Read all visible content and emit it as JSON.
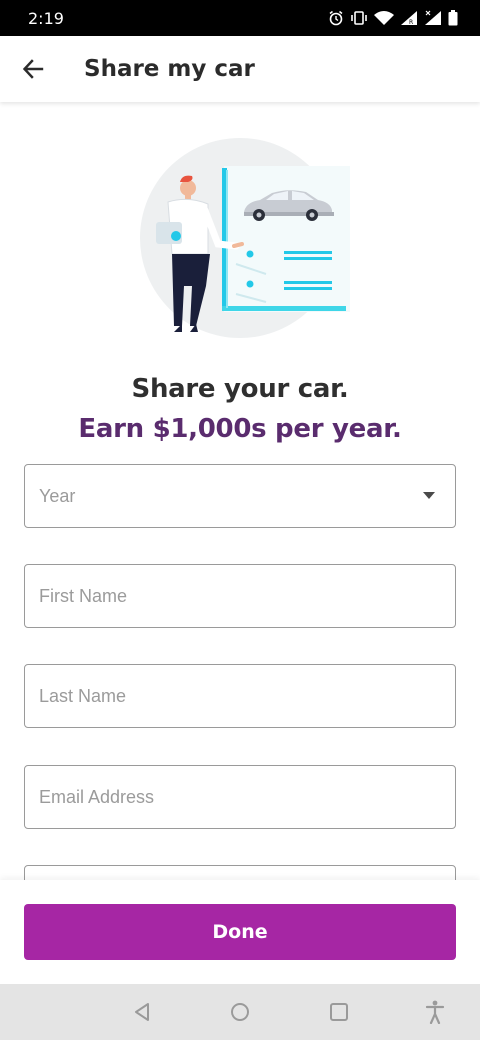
{
  "status_bar": {
    "time": "2:19",
    "icons": [
      "alarm-icon",
      "vibrate-icon",
      "wifi-icon",
      "signal-r-icon",
      "signal-x-icon",
      "battery-icon"
    ]
  },
  "app_bar": {
    "back_icon": "arrow-left-icon",
    "title": "Share my car"
  },
  "hero": {
    "illustration": "person-presenting-car-illustration"
  },
  "headline": "Share your car.",
  "subheadline": "Earn $1,000s per year.",
  "form": {
    "year": {
      "placeholder": "Year",
      "value": ""
    },
    "first_name": {
      "placeholder": "First Name",
      "value": ""
    },
    "last_name": {
      "placeholder": "Last Name",
      "value": ""
    },
    "email": {
      "placeholder": "Email Address",
      "value": ""
    }
  },
  "footer": {
    "done_label": "Done"
  },
  "colors": {
    "accent": "#a626a4",
    "subheadline": "#5a2c6e",
    "border": "#9a9a9a",
    "cyan": "#23c8e8"
  }
}
